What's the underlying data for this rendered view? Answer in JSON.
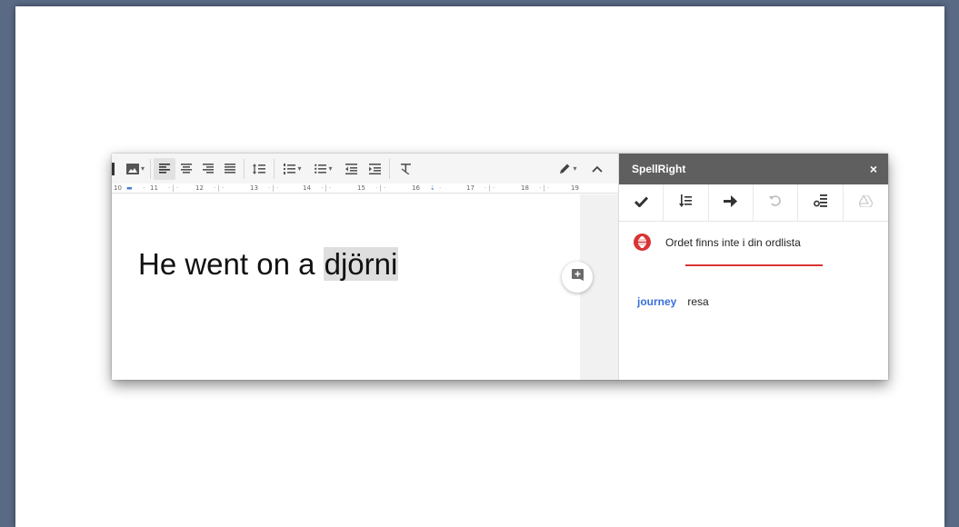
{
  "document": {
    "text_before": "He went on a ",
    "highlighted_word": "djörni"
  },
  "ruler": {
    "numbers": [
      "10",
      "11",
      "12",
      "13",
      "14",
      "15",
      "16",
      "17",
      "18",
      "19"
    ]
  },
  "toolbar": {
    "icons": [
      "image-icon",
      "align-left-icon",
      "align-center-icon",
      "align-right-icon",
      "align-justify-icon",
      "line-spacing-icon",
      "numbered-list-icon",
      "bulleted-list-icon",
      "decrease-indent-icon",
      "increase-indent-icon",
      "clear-formatting-icon",
      "pencil-icon",
      "collapse-icon"
    ]
  },
  "spellright": {
    "title": "SpellRight",
    "close_label": "×",
    "tools": [
      "check-icon",
      "sort-icon",
      "arrow-right-icon",
      "undo-icon",
      "settings-icon",
      "drive-icon"
    ],
    "message": "Ordet finns inte i din ordlista",
    "suggestion": {
      "word": "journey",
      "translation": "resa"
    }
  },
  "colors": {
    "background": "#5a6a84",
    "panel_header": "#5f5f5f",
    "error_red": "#d93434",
    "link_blue": "#3a6fd8"
  }
}
